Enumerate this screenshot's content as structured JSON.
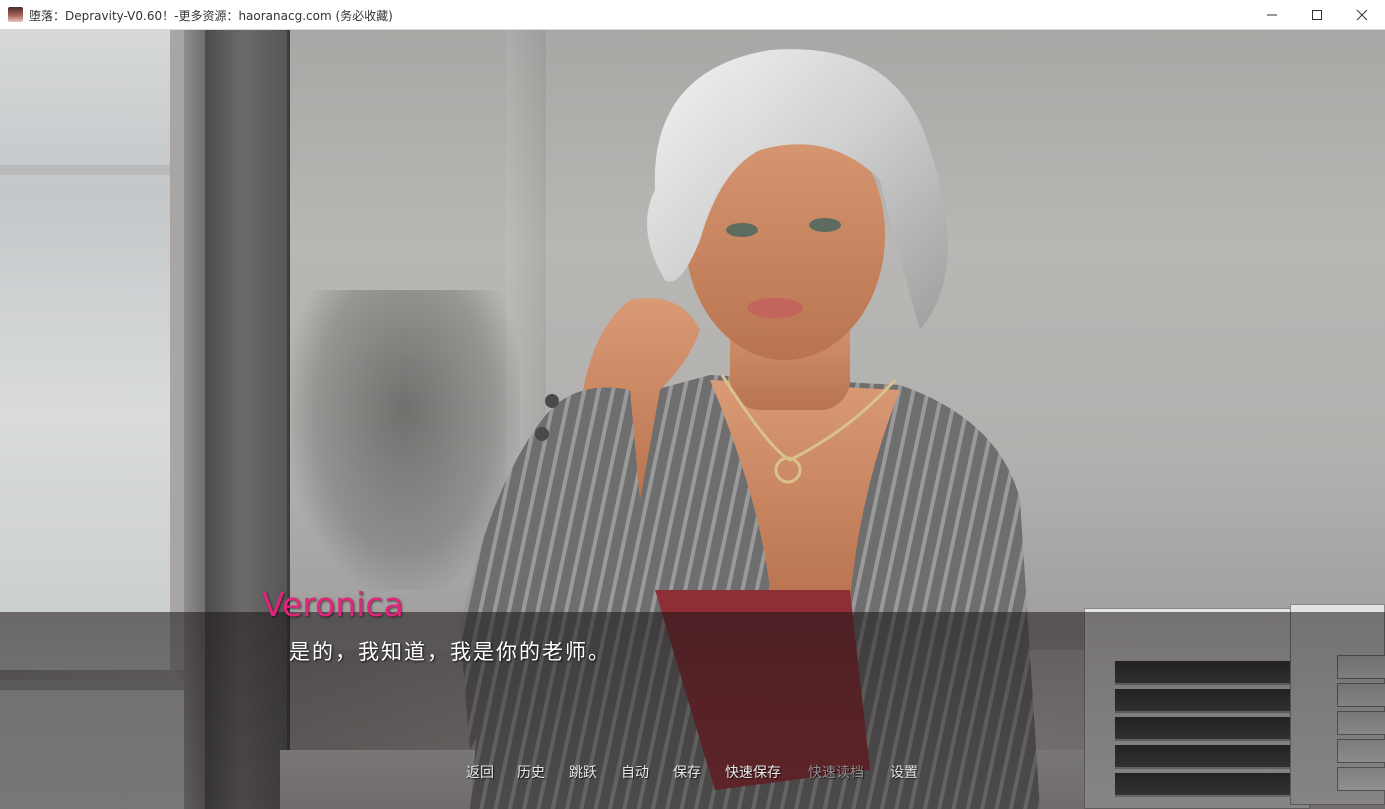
{
  "window": {
    "title": "堕落：Depravity-V0.60！-更多资源：haoranacg.com (务必收藏)",
    "controls": [
      "minimize",
      "maximize",
      "close"
    ]
  },
  "scene": {
    "speaker_name": "Veronica",
    "speaker_color": "#e0257a",
    "dialogue": "是的，我知道，我是你的老师。"
  },
  "quick_menu": {
    "items": [
      {
        "label": "返回",
        "enabled": true
      },
      {
        "label": "历史",
        "enabled": true
      },
      {
        "label": "跳跃",
        "enabled": true
      },
      {
        "label": "自动",
        "enabled": true
      },
      {
        "label": "保存",
        "enabled": true
      },
      {
        "label": "快速保存",
        "enabled": true
      },
      {
        "label": "快速读档",
        "enabled": false
      },
      {
        "label": "设置",
        "enabled": true
      }
    ]
  }
}
